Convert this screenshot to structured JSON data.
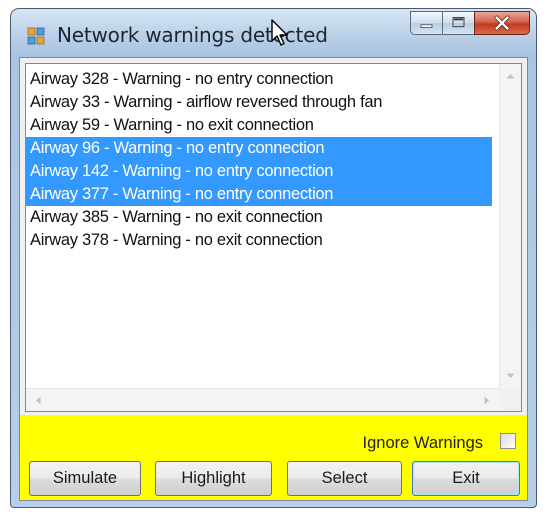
{
  "window": {
    "title": "Network warnings detected",
    "icons": {
      "app": "window-app-icon",
      "minimize": "minimize-icon",
      "maximize": "maximize-icon",
      "close": "close-icon",
      "cursor": "mouse-cursor-icon"
    }
  },
  "warnings": {
    "items": [
      {
        "text": "Airway  328 - Warning - no entry connection",
        "selected": false
      },
      {
        "text": "Airway  33 - Warning - airflow reversed through fan",
        "selected": false
      },
      {
        "text": "Airway  59 - Warning - no exit connection",
        "selected": false
      },
      {
        "text": "Airway  96 - Warning - no entry connection",
        "selected": true
      },
      {
        "text": "Airway  142 - Warning - no entry connection",
        "selected": true
      },
      {
        "text": "Airway  377 - Warning - no entry connection",
        "selected": true
      },
      {
        "text": "Airway  385 - Warning - no exit connection",
        "selected": false
      },
      {
        "text": "Airway  378 - Warning - no exit connection",
        "selected": false
      }
    ]
  },
  "options": {
    "ignore_warnings_label": "Ignore Warnings",
    "ignore_warnings_checked": false
  },
  "buttons": {
    "simulate": "Simulate",
    "highlight": "Highlight",
    "select": "Select",
    "exit": "Exit"
  },
  "colors": {
    "selection": "#3399ff",
    "panel": "#ffff00"
  }
}
